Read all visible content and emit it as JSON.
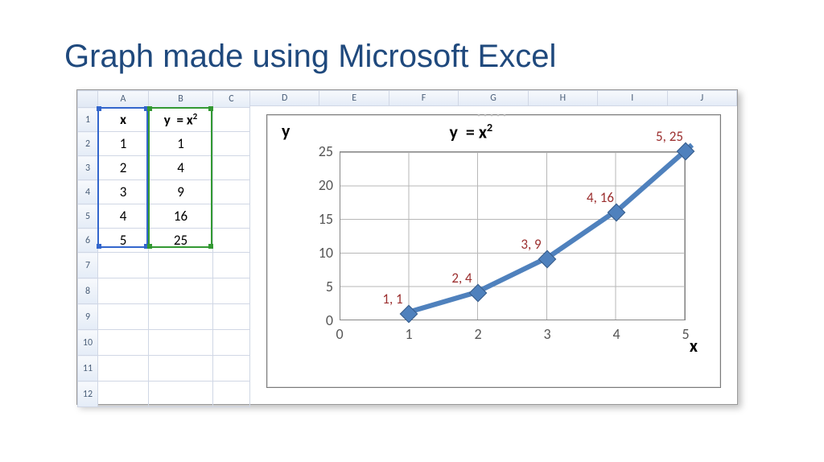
{
  "title": "Graph made using Microsoft Excel",
  "columns": [
    "A",
    "B",
    "C"
  ],
  "extra_columns": [
    "D",
    "E",
    "F",
    "G",
    "H",
    "I",
    "J"
  ],
  "headers": {
    "x": "x",
    "y_html": "y  = x²"
  },
  "rows": [
    {
      "n": "1",
      "x": "x",
      "y": "y  = x²"
    },
    {
      "n": "2",
      "x": "1",
      "y": "1"
    },
    {
      "n": "3",
      "x": "2",
      "y": "4"
    },
    {
      "n": "4",
      "x": "3",
      "y": "9"
    },
    {
      "n": "5",
      "x": "4",
      "y": "16"
    },
    {
      "n": "6",
      "x": "5",
      "y": "25"
    },
    {
      "n": "7",
      "x": "",
      "y": ""
    },
    {
      "n": "8",
      "x": "",
      "y": ""
    },
    {
      "n": "9",
      "x": "",
      "y": ""
    },
    {
      "n": "10",
      "x": "",
      "y": ""
    },
    {
      "n": "11",
      "x": "",
      "y": ""
    },
    {
      "n": "12",
      "x": "",
      "y": ""
    }
  ],
  "chart_data": {
    "type": "line",
    "title": "y  = x²",
    "xlabel": "x",
    "ylabel": "y",
    "xlim": [
      0,
      5
    ],
    "ylim": [
      0,
      25
    ],
    "y_ticks": [
      0,
      5,
      10,
      15,
      20,
      25
    ],
    "x_ticks": [
      0,
      1,
      2,
      3,
      4,
      5
    ],
    "x": [
      1,
      2,
      3,
      4,
      5
    ],
    "values": [
      1,
      4,
      9,
      16,
      25
    ],
    "point_labels": [
      "1, 1",
      "2, 4",
      "3, 9",
      "4, 16",
      "5, 25"
    ]
  }
}
